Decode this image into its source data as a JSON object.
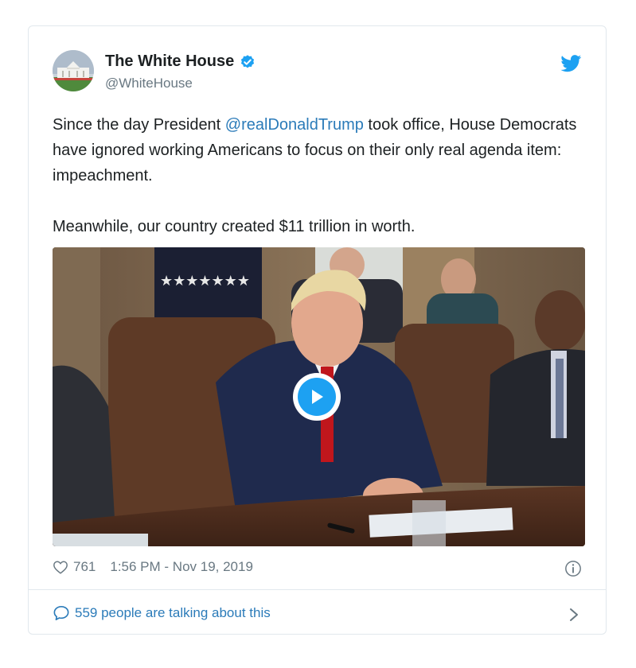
{
  "tweet": {
    "author_name": "The White House",
    "handle": "@WhiteHouse",
    "text_before_mention": "Since the day President ",
    "mention": "@realDonaldTrump",
    "text_after_mention": " took office, House Democrats have ignored working Americans to focus on their only real agenda item: impeachment.",
    "text_second": "Meanwhile, our country created $11 trillion in worth.",
    "likes": "761",
    "timestamp": "1:56 PM - Nov 19, 2019",
    "talking": "559 people are talking about this"
  },
  "icons": {
    "verified": "verified-badge-icon",
    "brand": "twitter-bird-icon",
    "play": "play-icon",
    "like": "heart-icon",
    "info": "info-icon",
    "comment": "comment-bubble-icon",
    "chevron": "chevron-right-icon"
  },
  "colors": {
    "accent": "#1da1f2",
    "link": "#2b7bb9",
    "muted": "#697882",
    "text": "#1c2022"
  }
}
